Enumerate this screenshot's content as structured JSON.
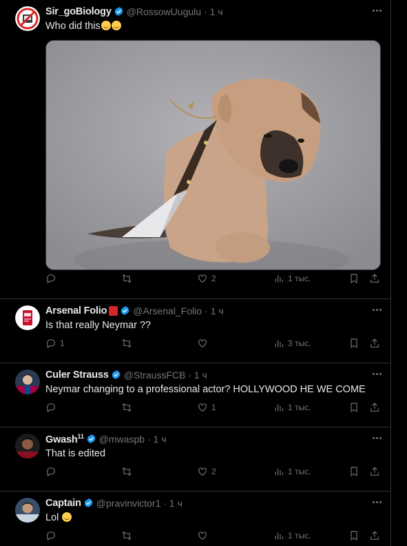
{
  "tweets": [
    {
      "name": "Sir_goBiology",
      "handle": "@RossowUugulu",
      "time": "· 1 ч",
      "text": "Who did this",
      "emoji": "😒😂",
      "replies": "",
      "retweets": "",
      "likes": "2",
      "views": "1 тыс.",
      "has_media": true
    },
    {
      "name": "Arsenal Folio",
      "handle": "@Arsenal_Folio",
      "time": "· 1 ч",
      "text": "Is that really Neymar ??",
      "replies": "1",
      "retweets": "",
      "likes": "",
      "views": "3 тыс."
    },
    {
      "name": "Culer Strauss",
      "handle": "@StraussFCB",
      "time": "· 1 ч",
      "text": "Neymar changing to a professional actor? HOLLYWOOD HE WE COME",
      "replies": "",
      "retweets": "",
      "likes": "1",
      "views": "1 тыс."
    },
    {
      "name": "Gwash",
      "name_sup": "11",
      "handle": "@mwaspb",
      "time": "· 1 ч",
      "text": "That is edited",
      "replies": "",
      "retweets": "",
      "likes": "2",
      "views": "1 тыс."
    },
    {
      "name": "Captain",
      "handle": "@pravinvictor1",
      "time": "· 1 ч",
      "text": "Lol",
      "replies": "",
      "retweets": "",
      "likes": "",
      "views": "1 тыс."
    }
  ],
  "colors": {
    "background": "#000000",
    "text": "#e7e9ea",
    "muted": "#71767b",
    "verified": "#1d9bf0",
    "border": "#2f3336"
  }
}
